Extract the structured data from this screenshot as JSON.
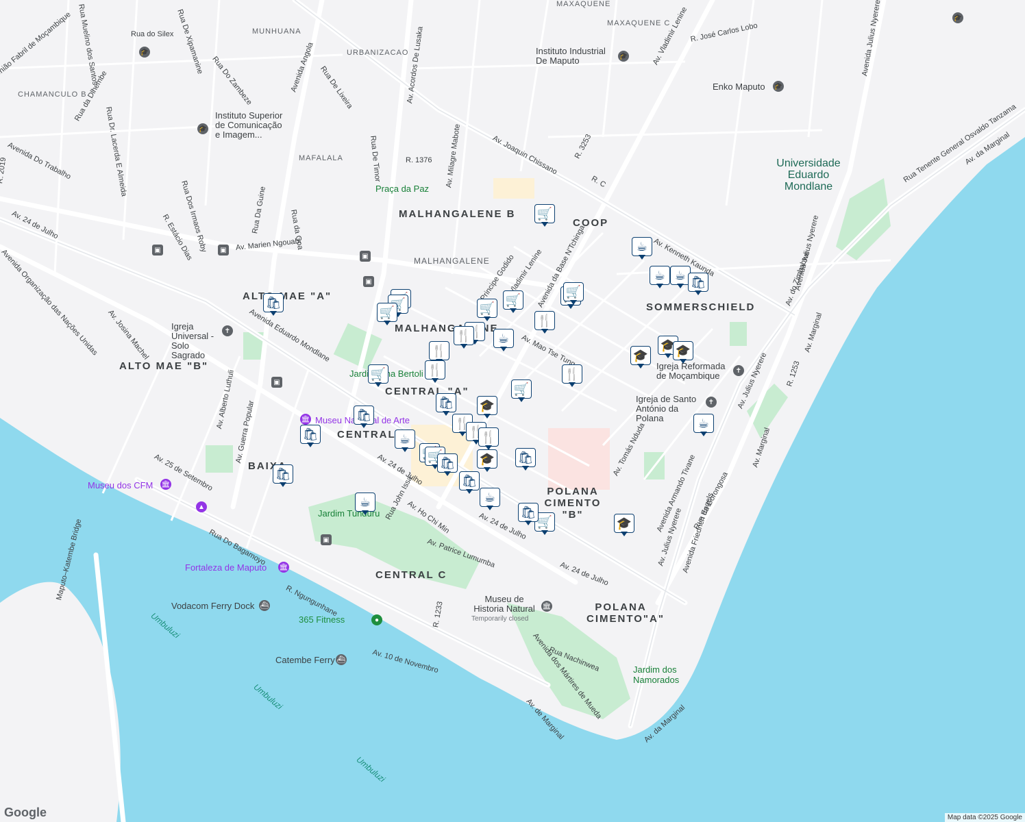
{
  "map": {
    "attribution": "Map data ©2025 Google",
    "logo": "Google",
    "colors": {
      "water": "#8fd9ee",
      "land": "#f3f3f5",
      "park": "#c8ecd1",
      "road": "#ffffff",
      "major_road": "#e3e6ea",
      "pin_border": "#0b3f70"
    }
  },
  "neighborhoods": [
    "MALHANGALENE B",
    "COOP",
    "MALHANGALENE",
    "SOMMERSCHIELD",
    "ALTO MAE \"A\"",
    "ALTO MAE \"B\"",
    "CENTRAL \"A\"",
    "CENTRAL",
    "BAIXA",
    "POLANA CIMENTO \"B\"",
    "CENTRAL C",
    "POLANA CIMENTO\"A\"",
    "MALHANGALENE"
  ],
  "small_areas": [
    "MUNHUANA",
    "URBANIZACAO",
    "MAXAQUENE",
    "MAXAQUENE C",
    "CHAMANCULO B",
    "MAFALALA"
  ],
  "roads": [
    "Rua do Silex",
    "Rua De Xipamanine",
    "Rua Do Zambeze",
    "Avenida Angola",
    "Rua De Lixeira",
    "Avenida Do Trabalho",
    "Av. Acordos De Lusaka",
    "Av. Joaquin Chissano",
    "Av. Milagre Mabote",
    "R. 1376",
    "Rua De Timor",
    "Av. Vladimir Lenine",
    "R. José Carlos Lobo",
    "Avenida Julius Nyerere",
    "Av. Kenneth Kaunda",
    "R. 3253",
    "R. C",
    "Av. 24 de Julho",
    "Avenida Eduardo Mondlane",
    "Av. Marien Ngouabi",
    "Rua Dos Irmaos Roby",
    "R. Estácio Dias",
    "Rua Da Guine",
    "Rua da Goa",
    "Avenida Organização das Nações Unidas",
    "Av. Josina Machel",
    "Av. Alberto Luthuli",
    "Av. Guerra Popular",
    "Av. 25 de Setembro",
    "Rua Do Bagamoyo",
    "R. Ngungunhane",
    "Av. 10 de Novembro",
    "Av. Patrice Lumumba",
    "Rua John Issa",
    "Av. Ho Chi Min",
    "Av. Mao Tse Tung",
    "Avenida da Base N'Tchinga",
    "Av. Tomás Nduda",
    "Avenida Armando Tivane",
    "Av. Julius Nyerere",
    "Avenida Friedrich Engels",
    "Rua da Gorongosa",
    "Av. Marginal",
    "Av. da Marginal",
    "Av. de Marginal",
    "Rua Nachinwea",
    "Avenida dos Mártires de Mueda",
    "Maputo–Katembe Bridge",
    "Av. do Zimbabwe",
    "Rua Tenente General Osvaldo Tanzama",
    "R. 1253",
    "R. 1233",
    "Rua Dr. Lacerda E Almeida",
    "Rua da Dlhembe",
    "R. 2019",
    "Principe Godido",
    "Vladimir Lenine",
    "Av. 24 de Julho",
    "Rua Dr. Lacerda"
  ],
  "water_labels": [
    "Umbuluzi",
    "Umbuluzi",
    "Umbuluzi"
  ],
  "parks": [
    "Praça da Paz",
    "Jardim Tunduru",
    "Jardim dos Namorados",
    "Jardim Tina Bertoli"
  ],
  "pois": {
    "instituto_industrial": "Instituto Industrial De Maputo",
    "enko": "Enko Maputo",
    "iscim": "Instituto Superior de Comunicação e Imagem...",
    "universidade": "Universidade Eduardo Mondlane",
    "igreja_universal": "Igreja Universal - Solo Sagrado",
    "museu_arte": "Museu Nacional de Arte",
    "museu_cfm": "Museu dos CFM",
    "fortaleza": "Fortaleza de Maputo",
    "vodacom_ferry": "Vodacom Ferry Dock",
    "fitness": "365 Fitness",
    "catembe_ferry": "Catembe Ferry",
    "museu_historia": "Museu de Historia Natural",
    "museu_historia_status": "Temporarily closed",
    "igreja_reformada": "Igreja Reformada de Moçambique",
    "igreja_antonio": "Igreja de Santo António da Polana",
    "fabril": "União Fabril de Moçambique",
    "rua_mulheres": "Rua Muelino dos Santos"
  },
  "pin_icons": {
    "grocery": "🛒",
    "restaurant": "🍴",
    "cafe": "☕",
    "shop": "🛍",
    "school": "🎓"
  },
  "pins": [
    {
      "type": "grocery"
    },
    {
      "type": "grocery"
    },
    {
      "type": "grocery"
    },
    {
      "type": "grocery"
    },
    {
      "type": "grocery"
    },
    {
      "type": "grocery"
    },
    {
      "type": "grocery"
    },
    {
      "type": "grocery"
    },
    {
      "type": "grocery"
    },
    {
      "type": "grocery"
    },
    {
      "type": "grocery"
    },
    {
      "type": "grocery"
    },
    {
      "type": "grocery"
    },
    {
      "type": "restaurant"
    },
    {
      "type": "restaurant"
    },
    {
      "type": "restaurant"
    },
    {
      "type": "restaurant"
    },
    {
      "type": "restaurant"
    },
    {
      "type": "restaurant"
    },
    {
      "type": "restaurant"
    },
    {
      "type": "restaurant"
    },
    {
      "type": "restaurant"
    },
    {
      "type": "cafe"
    },
    {
      "type": "cafe"
    },
    {
      "type": "cafe"
    },
    {
      "type": "cafe"
    },
    {
      "type": "cafe"
    },
    {
      "type": "cafe"
    },
    {
      "type": "cafe"
    },
    {
      "type": "cafe"
    },
    {
      "type": "shop"
    },
    {
      "type": "shop"
    },
    {
      "type": "shop"
    },
    {
      "type": "shop"
    },
    {
      "type": "shop"
    },
    {
      "type": "shop"
    },
    {
      "type": "shop"
    },
    {
      "type": "shop"
    },
    {
      "type": "shop"
    },
    {
      "type": "shop"
    },
    {
      "type": "school"
    },
    {
      "type": "school"
    },
    {
      "type": "school"
    },
    {
      "type": "school"
    },
    {
      "type": "school"
    },
    {
      "type": "school"
    }
  ]
}
